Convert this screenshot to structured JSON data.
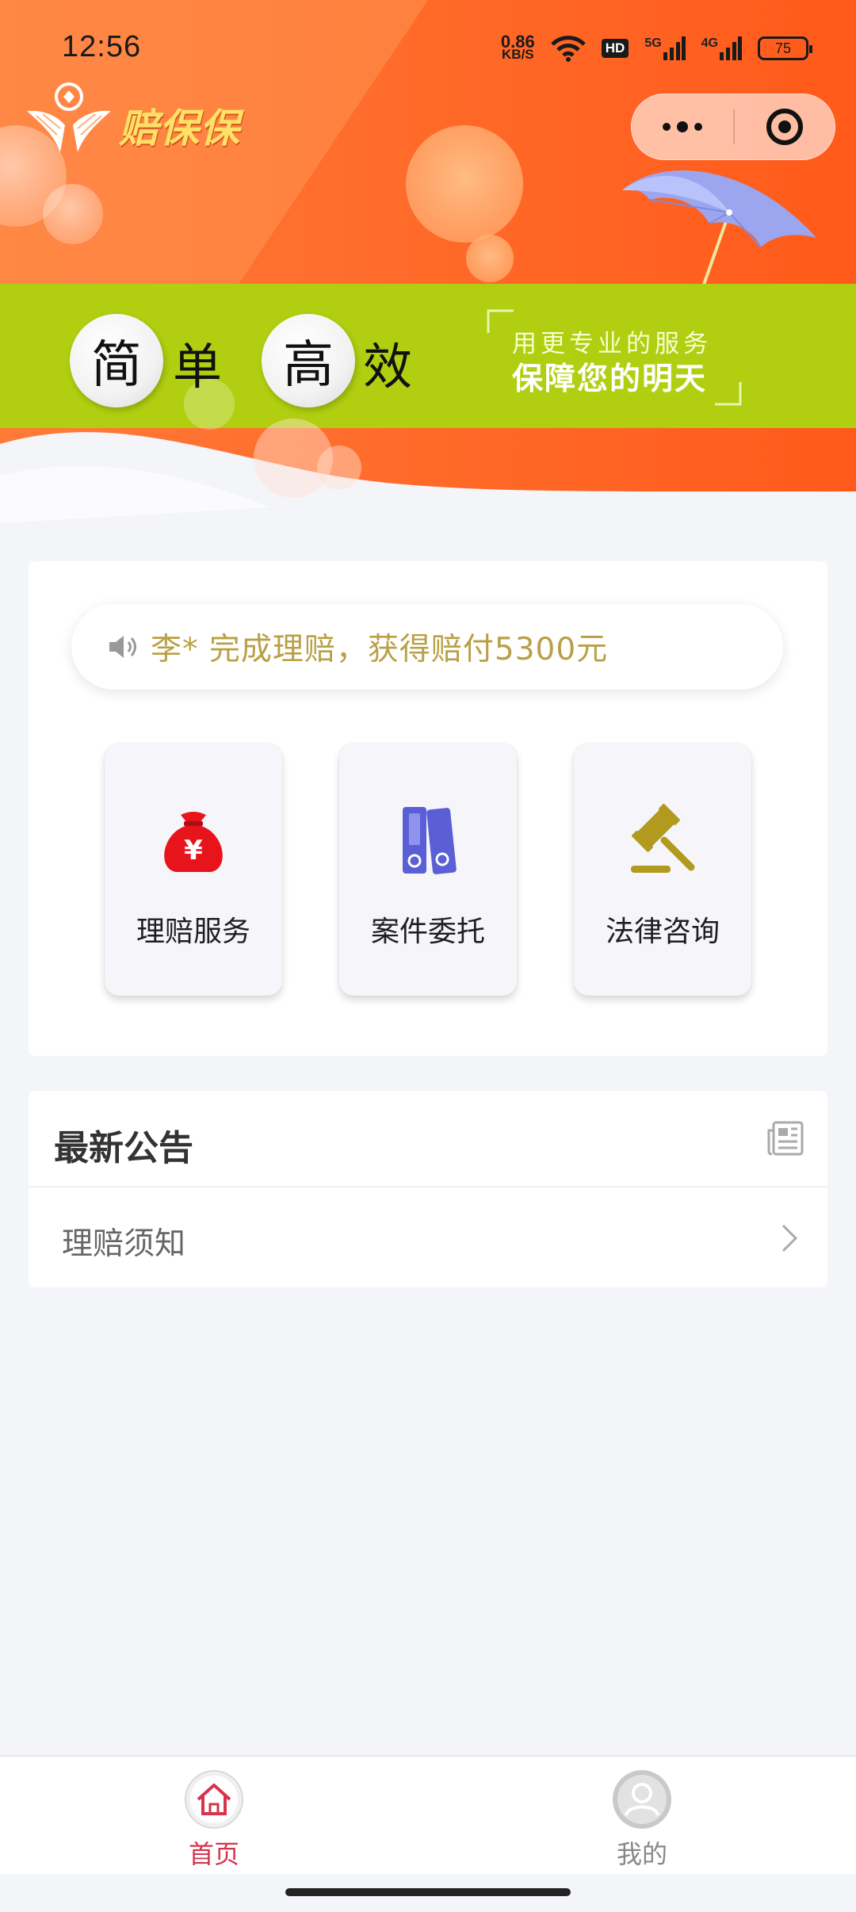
{
  "status_bar": {
    "time": "12:56",
    "net_speed_value": "0.86",
    "net_speed_unit": "KB/S",
    "hd_badge": "HD",
    "signal1_label": "5G",
    "signal2_label": "4G",
    "battery": "75"
  },
  "header": {
    "logo_text": "赔保保",
    "capsule_icons": [
      "more-dots-icon",
      "close-target-icon"
    ]
  },
  "hero": {
    "slogan_chars": [
      "简",
      "单",
      "高",
      "效"
    ],
    "tagline_line1": "用更专业的服务",
    "tagline_line2": "保障您的明天"
  },
  "notice": {
    "icon": "speaker-icon",
    "text": "李* 完成理赔，获得赔付5300元"
  },
  "services": [
    {
      "label": "理赔服务",
      "icon": "money-bag-icon"
    },
    {
      "label": "案件委托",
      "icon": "binders-icon"
    },
    {
      "label": "法律咨询",
      "icon": "gavel-icon"
    }
  ],
  "announcements": {
    "title": "最新公告",
    "icon": "newspaper-icon",
    "items": [
      {
        "label": "理赔须知"
      }
    ]
  },
  "tabbar": {
    "tabs": [
      {
        "label": "首页",
        "icon": "home-icon",
        "active": true
      },
      {
        "label": "我的",
        "icon": "user-icon",
        "active": false
      }
    ]
  },
  "colors": {
    "brand_orange": "#ff5a1f",
    "band_green": "#b1cf10",
    "notice_gold": "#b9a046",
    "tab_active": "#d6334d",
    "tab_inactive": "#888888"
  }
}
